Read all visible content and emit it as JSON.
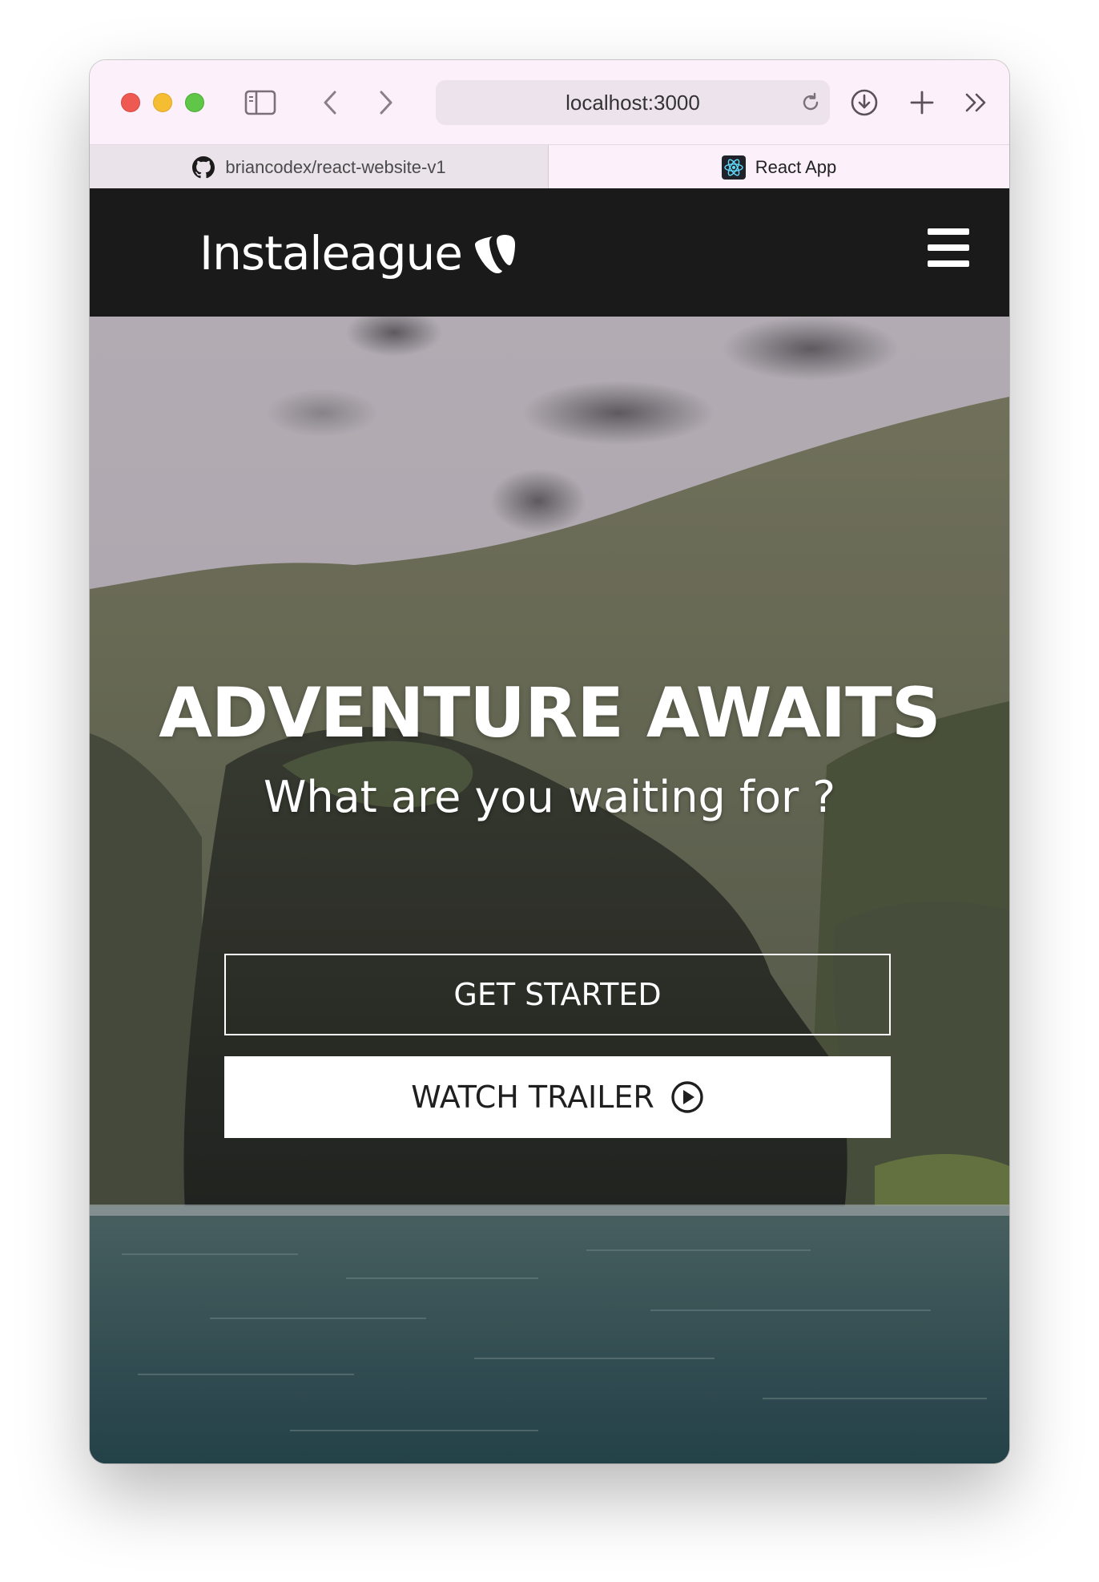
{
  "browser": {
    "address": "localhost:3000",
    "tabs": [
      {
        "label": "briancodex/react-website-v1",
        "icon": "github-icon",
        "active": false
      },
      {
        "label": "React App",
        "icon": "react-icon",
        "active": true
      }
    ]
  },
  "navbar": {
    "logo_text": "Instaleague",
    "logo_icon": "typo3-logo-icon",
    "menu_icon": "hamburger-menu-icon",
    "background_color": "#1b1a1b"
  },
  "hero": {
    "title": "ADVENTURE AWAITS",
    "subtitle": "What are you waiting for ?",
    "buttons": {
      "get_started": "GET STARTED",
      "watch_trailer": "WATCH TRAILER"
    },
    "watch_trailer_icon": "play-circle-icon"
  }
}
